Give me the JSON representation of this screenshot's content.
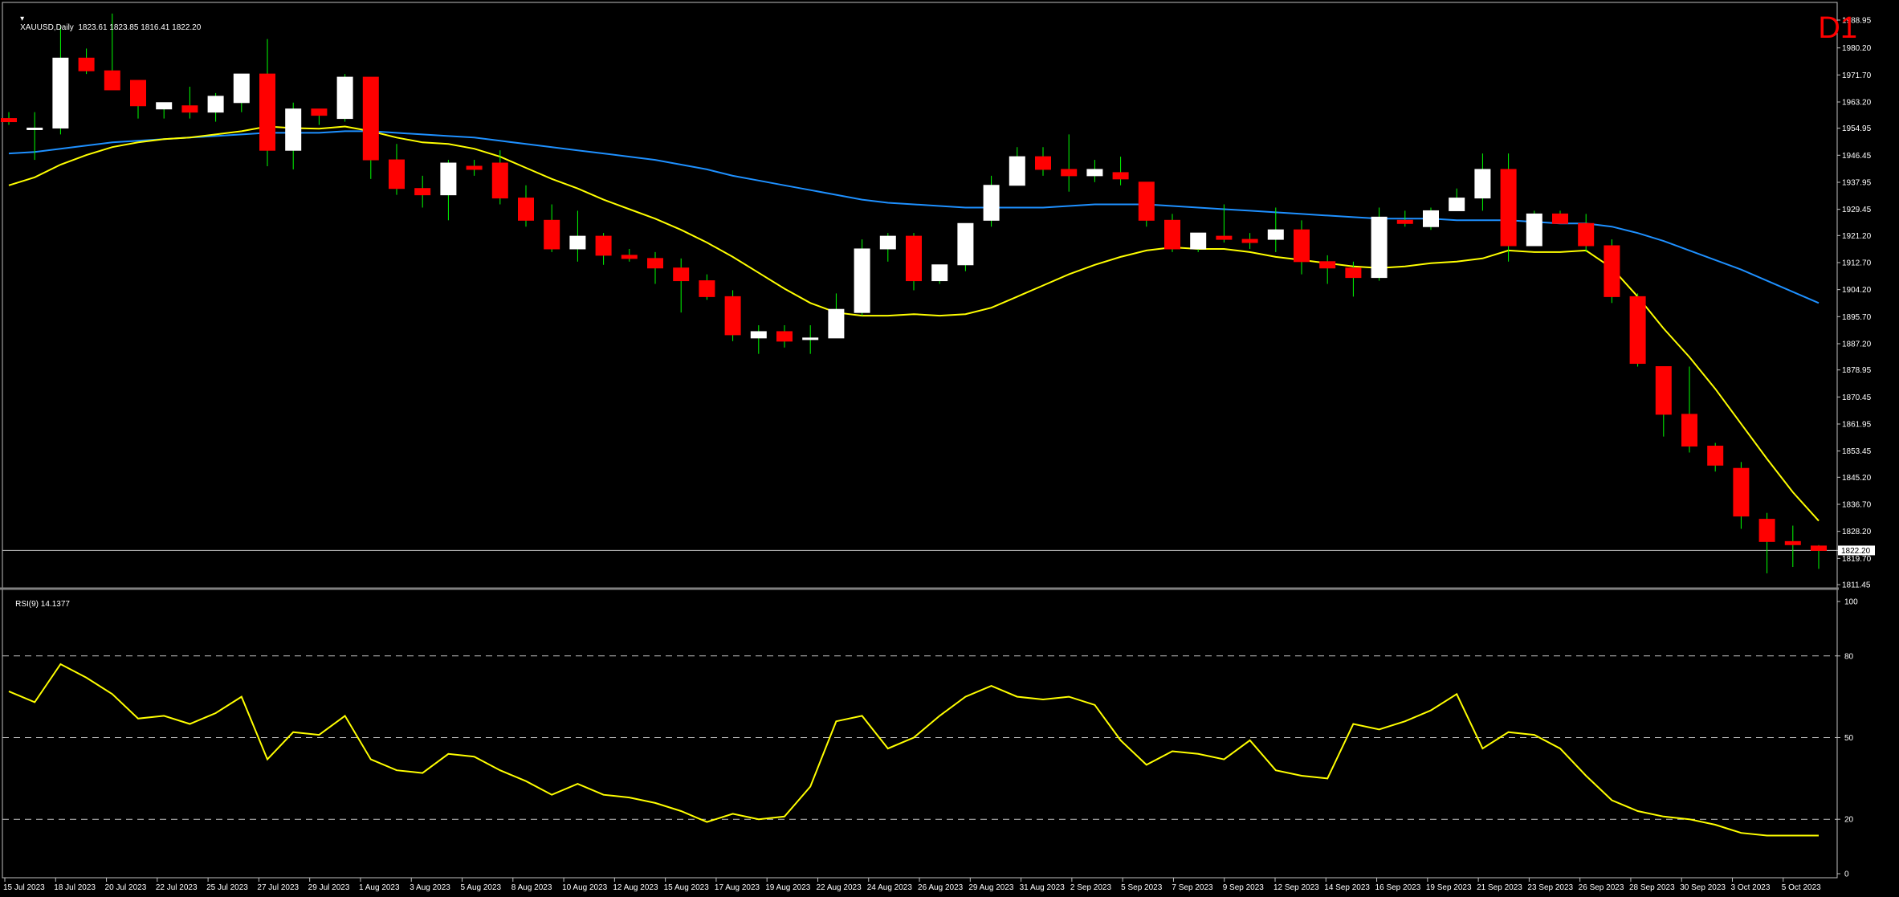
{
  "header": {
    "symbol_line": "XAUUSD,Daily  1823.61 1823.85 1816.41 1822.20",
    "timeframe": "D1",
    "rsi_line": "RSI(9) 14.1377"
  },
  "colors": {
    "background": "#000000",
    "bull_body": "#ffffff",
    "bear_body": "#ff0000",
    "wick": "#00ff00",
    "ma_fast": "#ffff00",
    "ma_slow": "#1e90ff",
    "rsi": "#ffff00",
    "grid": "#c0c0c0",
    "timeframe_label": "#ff0000"
  },
  "chart_data": [
    {
      "type": "candlestick",
      "symbol": "XAUUSD",
      "timeframe": "Daily",
      "ylim": [
        1811.45,
        1988.95
      ],
      "y_ticks": [
        "1988.95",
        "1980.20",
        "1971.70",
        "1963.20",
        "1954.95",
        "1946.45",
        "1937.95",
        "1929.45",
        "1921.20",
        "1912.70",
        "1904.20",
        "1895.70",
        "1887.20",
        "1878.95",
        "1870.45",
        "1861.95",
        "1853.45",
        "1845.20",
        "1836.70",
        "1828.20",
        "1822.20",
        "1819.70",
        "1811.45"
      ],
      "current_price": 1822.2,
      "x_ticks": [
        "15 Jul 2023",
        "18 Jul 2023",
        "20 Jul 2023",
        "22 Jul 2023",
        "25 Jul 2023",
        "27 Jul 2023",
        "29 Jul 2023",
        "1 Aug 2023",
        "3 Aug 2023",
        "5 Aug 2023",
        "8 Aug 2023",
        "10 Aug 2023",
        "12 Aug 2023",
        "15 Aug 2023",
        "17 Aug 2023",
        "19 Aug 2023",
        "22 Aug 2023",
        "24 Aug 2023",
        "26 Aug 2023",
        "29 Aug 2023",
        "31 Aug 2023",
        "2 Sep 2023",
        "5 Sep 2023",
        "7 Sep 2023",
        "9 Sep 2023",
        "12 Sep 2023",
        "14 Sep 2023",
        "16 Sep 2023",
        "19 Sep 2023",
        "21 Sep 2023",
        "23 Sep 2023",
        "26 Sep 2023",
        "28 Sep 2023",
        "30 Sep 2023",
        "3 Oct 2023",
        "5 Oct 2023"
      ],
      "candles": [
        {
          "o": 1958.0,
          "h": 1960.0,
          "l": 1956.0,
          "c": 1957.0
        },
        {
          "o": 1955.0,
          "h": 1960.0,
          "l": 1945.0,
          "c": 1955.0
        },
        {
          "o": 1955.0,
          "h": 1987.0,
          "l": 1953.0,
          "c": 1977.0
        },
        {
          "o": 1977.0,
          "h": 1980.0,
          "l": 1972.0,
          "c": 1973.0
        },
        {
          "o": 1973.0,
          "h": 1991.0,
          "l": 1968.0,
          "c": 1967.0
        },
        {
          "o": 1970.0,
          "h": 1970.0,
          "l": 1958.0,
          "c": 1962.0
        },
        {
          "o": 1961.0,
          "h": 1963.0,
          "l": 1958.0,
          "c": 1963.0
        },
        {
          "o": 1962.0,
          "h": 1968.0,
          "l": 1958.0,
          "c": 1960.0
        },
        {
          "o": 1960.0,
          "h": 1966.0,
          "l": 1957.0,
          "c": 1965.0
        },
        {
          "o": 1963.0,
          "h": 1972.0,
          "l": 1960.0,
          "c": 1972.0
        },
        {
          "o": 1972.0,
          "h": 1983.0,
          "l": 1943.0,
          "c": 1948.0
        },
        {
          "o": 1948.0,
          "h": 1963.0,
          "l": 1942.0,
          "c": 1961.0
        },
        {
          "o": 1961.0,
          "h": 1961.0,
          "l": 1956.0,
          "c": 1959.0
        },
        {
          "o": 1958.0,
          "h": 1972.0,
          "l": 1957.0,
          "c": 1971.0
        },
        {
          "o": 1971.0,
          "h": 1971.0,
          "l": 1939.0,
          "c": 1945.0
        },
        {
          "o": 1945.0,
          "h": 1950.0,
          "l": 1934.0,
          "c": 1936.0
        },
        {
          "o": 1936.0,
          "h": 1940.0,
          "l": 1930.0,
          "c": 1934.0
        },
        {
          "o": 1934.0,
          "h": 1945.0,
          "l": 1926.0,
          "c": 1944.0
        },
        {
          "o": 1943.0,
          "h": 1945.0,
          "l": 1940.0,
          "c": 1942.0
        },
        {
          "o": 1944.0,
          "h": 1948.0,
          "l": 1931.0,
          "c": 1933.0
        },
        {
          "o": 1933.0,
          "h": 1937.0,
          "l": 1924.0,
          "c": 1926.0
        },
        {
          "o": 1926.0,
          "h": 1931.0,
          "l": 1916.0,
          "c": 1917.0
        },
        {
          "o": 1917.0,
          "h": 1929.0,
          "l": 1913.0,
          "c": 1921.0
        },
        {
          "o": 1921.0,
          "h": 1922.0,
          "l": 1912.0,
          "c": 1915.0
        },
        {
          "o": 1915.0,
          "h": 1917.0,
          "l": 1913.0,
          "c": 1914.0
        },
        {
          "o": 1914.0,
          "h": 1916.0,
          "l": 1906.0,
          "c": 1911.0
        },
        {
          "o": 1911.0,
          "h": 1914.0,
          "l": 1897.0,
          "c": 1907.0
        },
        {
          "o": 1907.0,
          "h": 1909.0,
          "l": 1901.0,
          "c": 1902.0
        },
        {
          "o": 1902.0,
          "h": 1904.0,
          "l": 1888.0,
          "c": 1890.0
        },
        {
          "o": 1889.0,
          "h": 1893.0,
          "l": 1884.0,
          "c": 1891.0
        },
        {
          "o": 1891.0,
          "h": 1893.0,
          "l": 1886.0,
          "c": 1888.0
        },
        {
          "o": 1889.0,
          "h": 1893.0,
          "l": 1884.0,
          "c": 1889.0
        },
        {
          "o": 1889.0,
          "h": 1903.0,
          "l": 1889.0,
          "c": 1898.0
        },
        {
          "o": 1897.0,
          "h": 1920.0,
          "l": 1896.0,
          "c": 1917.0
        },
        {
          "o": 1917.0,
          "h": 1922.0,
          "l": 1913.0,
          "c": 1921.0
        },
        {
          "o": 1921.0,
          "h": 1922.0,
          "l": 1904.0,
          "c": 1907.0
        },
        {
          "o": 1907.0,
          "h": 1912.0,
          "l": 1906.0,
          "c": 1912.0
        },
        {
          "o": 1912.0,
          "h": 1925.0,
          "l": 1910.0,
          "c": 1925.0
        },
        {
          "o": 1926.0,
          "h": 1940.0,
          "l": 1924.0,
          "c": 1937.0
        },
        {
          "o": 1937.0,
          "h": 1949.0,
          "l": 1937.0,
          "c": 1946.0
        },
        {
          "o": 1946.0,
          "h": 1949.0,
          "l": 1940.0,
          "c": 1942.0
        },
        {
          "o": 1942.0,
          "h": 1953.0,
          "l": 1935.0,
          "c": 1940.0
        },
        {
          "o": 1940.0,
          "h": 1945.0,
          "l": 1938.0,
          "c": 1942.0
        },
        {
          "o": 1941.0,
          "h": 1946.0,
          "l": 1937.0,
          "c": 1939.0
        },
        {
          "o": 1938.0,
          "h": 1938.0,
          "l": 1924.0,
          "c": 1926.0
        },
        {
          "o": 1926.0,
          "h": 1928.0,
          "l": 1916.0,
          "c": 1917.0
        },
        {
          "o": 1917.0,
          "h": 1922.0,
          "l": 1916.0,
          "c": 1922.0
        },
        {
          "o": 1921.0,
          "h": 1931.0,
          "l": 1919.0,
          "c": 1920.0
        },
        {
          "o": 1920.0,
          "h": 1922.0,
          "l": 1917.0,
          "c": 1919.0
        },
        {
          "o": 1920.0,
          "h": 1930.0,
          "l": 1916.0,
          "c": 1923.0
        },
        {
          "o": 1923.0,
          "h": 1926.0,
          "l": 1909.0,
          "c": 1913.0
        },
        {
          "o": 1913.0,
          "h": 1915.0,
          "l": 1906.0,
          "c": 1911.0
        },
        {
          "o": 1911.0,
          "h": 1913.0,
          "l": 1902.0,
          "c": 1908.0
        },
        {
          "o": 1908.0,
          "h": 1930.0,
          "l": 1907.0,
          "c": 1927.0
        },
        {
          "o": 1926.0,
          "h": 1929.0,
          "l": 1924.0,
          "c": 1925.0
        },
        {
          "o": 1924.0,
          "h": 1930.0,
          "l": 1923.0,
          "c": 1929.0
        },
        {
          "o": 1929.0,
          "h": 1936.0,
          "l": 1929.0,
          "c": 1933.0
        },
        {
          "o": 1933.0,
          "h": 1947.0,
          "l": 1929.0,
          "c": 1942.0
        },
        {
          "o": 1942.0,
          "h": 1947.0,
          "l": 1913.0,
          "c": 1918.0
        },
        {
          "o": 1918.0,
          "h": 1929.0,
          "l": 1918.0,
          "c": 1928.0
        },
        {
          "o": 1928.0,
          "h": 1929.0,
          "l": 1925.0,
          "c": 1925.0
        },
        {
          "o": 1925.0,
          "h": 1928.0,
          "l": 1916.0,
          "c": 1918.0
        },
        {
          "o": 1918.0,
          "h": 1920.0,
          "l": 1900.0,
          "c": 1902.0
        },
        {
          "o": 1902.0,
          "h": 1903.0,
          "l": 1880.0,
          "c": 1881.0
        },
        {
          "o": 1880.0,
          "h": 1880.0,
          "l": 1858.0,
          "c": 1865.0
        },
        {
          "o": 1865.0,
          "h": 1880.0,
          "l": 1853.0,
          "c": 1855.0
        },
        {
          "o": 1855.0,
          "h": 1856.0,
          "l": 1847.0,
          "c": 1849.0
        },
        {
          "o": 1848.0,
          "h": 1850.0,
          "l": 1829.0,
          "c": 1833.0
        },
        {
          "o": 1832.0,
          "h": 1834.0,
          "l": 1815.0,
          "c": 1825.0
        },
        {
          "o": 1825.0,
          "h": 1830.0,
          "l": 1817.0,
          "c": 1824.0
        },
        {
          "o": 1823.6,
          "h": 1823.9,
          "l": 1816.4,
          "c": 1822.2
        }
      ],
      "ma_fast": [
        1937.0,
        1939.5,
        1943.5,
        1946.5,
        1949.0,
        1950.5,
        1951.5,
        1952.0,
        1953.0,
        1954.0,
        1955.5,
        1955.0,
        1954.8,
        1955.5,
        1954.0,
        1952.0,
        1950.5,
        1950.0,
        1948.5,
        1946.0,
        1942.5,
        1939.0,
        1936.0,
        1932.5,
        1929.5,
        1926.5,
        1923.0,
        1919.0,
        1914.5,
        1909.5,
        1904.5,
        1900.0,
        1897.0,
        1896.0,
        1896.0,
        1896.5,
        1896.0,
        1896.5,
        1898.5,
        1902.0,
        1905.5,
        1909.0,
        1912.0,
        1914.5,
        1916.5,
        1917.5,
        1917.0,
        1917.0,
        1916.0,
        1914.5,
        1913.5,
        1912.5,
        1911.5,
        1911.0,
        1911.5,
        1912.5,
        1913.0,
        1914.0,
        1916.5,
        1916.0,
        1916.0,
        1916.5,
        1911.0,
        1902.0,
        1892.0,
        1883.0,
        1873.0,
        1862.0,
        1851.0,
        1840.5,
        1831.5
      ],
      "ma_slow": [
        1947.0,
        1947.5,
        1948.5,
        1949.5,
        1950.5,
        1951.0,
        1951.5,
        1952.0,
        1952.5,
        1953.0,
        1953.5,
        1953.5,
        1953.5,
        1954.0,
        1954.0,
        1953.5,
        1953.0,
        1952.5,
        1952.0,
        1951.0,
        1950.0,
        1949.0,
        1948.0,
        1947.0,
        1946.0,
        1945.0,
        1943.5,
        1942.0,
        1940.0,
        1938.5,
        1937.0,
        1935.5,
        1934.0,
        1932.5,
        1931.5,
        1931.0,
        1930.5,
        1930.0,
        1930.0,
        1930.0,
        1930.0,
        1930.5,
        1931.0,
        1931.0,
        1931.0,
        1930.5,
        1930.0,
        1929.5,
        1929.0,
        1928.5,
        1928.0,
        1927.5,
        1927.0,
        1926.5,
        1926.5,
        1926.5,
        1926.0,
        1926.0,
        1926.0,
        1925.5,
        1925.0,
        1925.0,
        1924.0,
        1922.0,
        1919.5,
        1916.5,
        1913.5,
        1910.5,
        1907.0,
        1903.5,
        1900.0
      ]
    },
    {
      "type": "line",
      "title": "RSI(9) 14.1377",
      "ylim": [
        0,
        100
      ],
      "y_ticks": [
        100,
        80,
        50,
        20,
        0
      ],
      "levels": [
        80,
        50,
        20
      ],
      "series": [
        {
          "values": [
            67,
            63,
            77,
            72,
            66,
            57,
            58,
            55,
            59,
            65,
            42,
            52,
            51,
            58,
            42,
            38,
            37,
            44,
            43,
            38,
            34,
            29,
            33,
            29,
            28,
            26,
            23,
            19,
            22,
            20,
            21,
            32,
            56,
            58,
            46,
            50,
            58,
            65,
            69,
            65,
            64,
            65,
            62,
            49,
            40,
            45,
            44,
            42,
            49,
            38,
            36,
            35,
            55,
            53,
            56,
            60,
            66,
            46,
            52,
            51,
            46,
            36,
            27,
            23,
            21,
            20,
            18,
            15,
            14,
            14,
            14
          ]
        }
      ]
    }
  ]
}
